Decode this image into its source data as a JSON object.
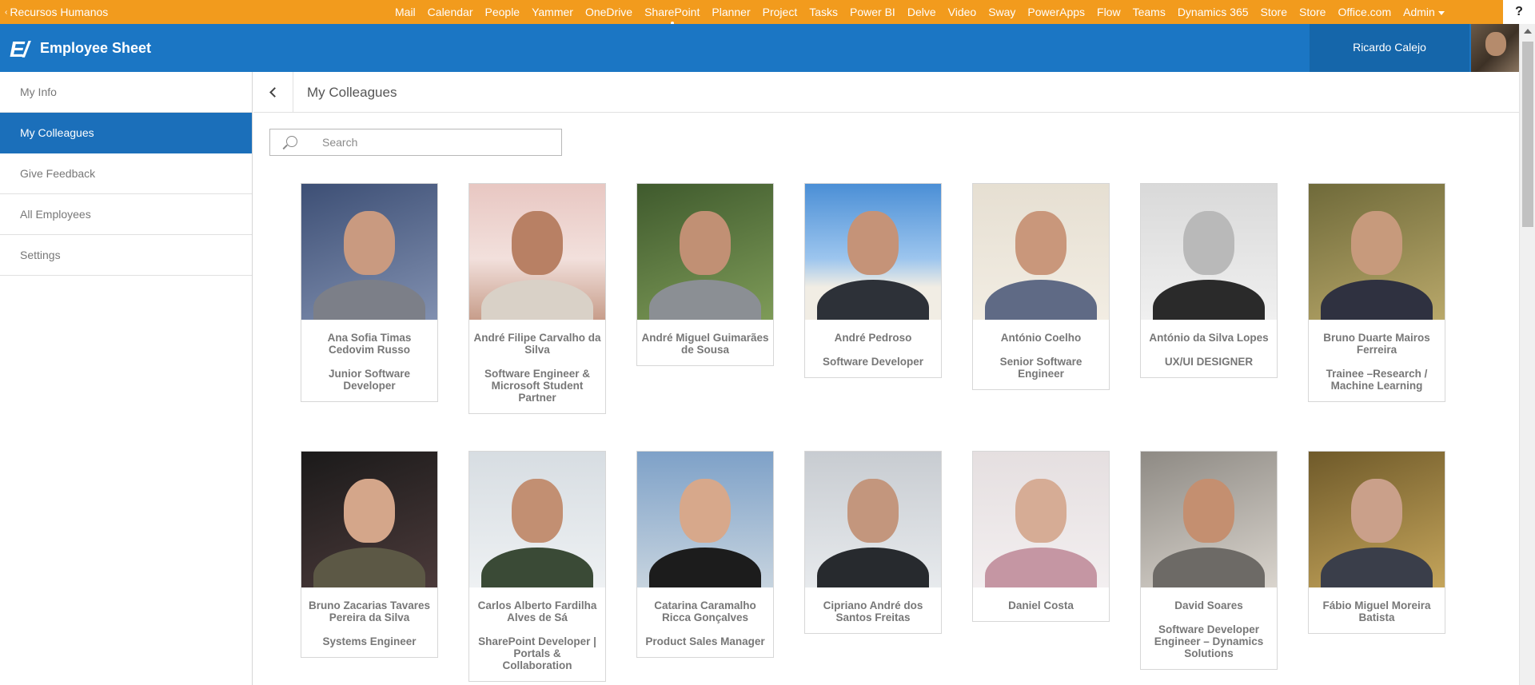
{
  "suite_bar": {
    "site_name": "Recursos Humanos",
    "links": [
      "Mail",
      "Calendar",
      "People",
      "Yammer",
      "OneDrive",
      "SharePoint",
      "Planner",
      "Project",
      "Tasks",
      "Power BI",
      "Delve",
      "Video",
      "Sway",
      "PowerApps",
      "Flow",
      "Teams",
      "Dynamics 365",
      "Store",
      "Store",
      "Office.com"
    ],
    "admin_label": "Admin",
    "help_label": "?"
  },
  "app": {
    "logo": "E/",
    "title": "Employee Sheet",
    "user_name": "Ricardo Calejo"
  },
  "sidebar": {
    "items": [
      {
        "label": "My Info"
      },
      {
        "label": "My Colleagues"
      },
      {
        "label": "Give Feedback"
      },
      {
        "label": "All Employees"
      },
      {
        "label": "Settings"
      }
    ],
    "active_index": 1
  },
  "page": {
    "title": "My Colleagues",
    "search_placeholder": "Search"
  },
  "colleagues": [
    {
      "name": "Ana Sofia Timas Cedovim Russo",
      "role": "Junior Software Developer"
    },
    {
      "name": "André Filipe Carvalho da Silva",
      "role": "Software Engineer & Microsoft Student Partner"
    },
    {
      "name": "André Miguel Guimarães de Sousa",
      "role": ""
    },
    {
      "name": "André Pedroso",
      "role": "Software Developer"
    },
    {
      "name": "António Coelho",
      "role": "Senior Software Engineer"
    },
    {
      "name": "António da Silva Lopes",
      "role": "UX/UI DESIGNER"
    },
    {
      "name": "Bruno Duarte Mairos Ferreira",
      "role": "Trainee –Research / Machine Learning"
    },
    {
      "name": "Bruno Zacarias Tavares Pereira da Silva",
      "role": "Systems Engineer"
    },
    {
      "name": "Carlos Alberto Fardilha Alves de Sá",
      "role": "SharePoint Developer | Portals & Collaboration"
    },
    {
      "name": "Catarina Caramalho Ricca Gonçalves",
      "role": "Product Sales Manager"
    },
    {
      "name": "Cipriano André dos Santos Freitas",
      "role": ""
    },
    {
      "name": "Daniel Costa",
      "role": ""
    },
    {
      "name": "David Soares",
      "role": "Software Developer Engineer – Dynamics Solutions"
    },
    {
      "name": "Fábio Miguel Moreira Batista",
      "role": ""
    }
  ],
  "colors": {
    "suite_bar": "#f29b1d",
    "app_bar": "#1b76c4",
    "user_block": "#1566aa",
    "nav_active": "#1b6fba"
  }
}
